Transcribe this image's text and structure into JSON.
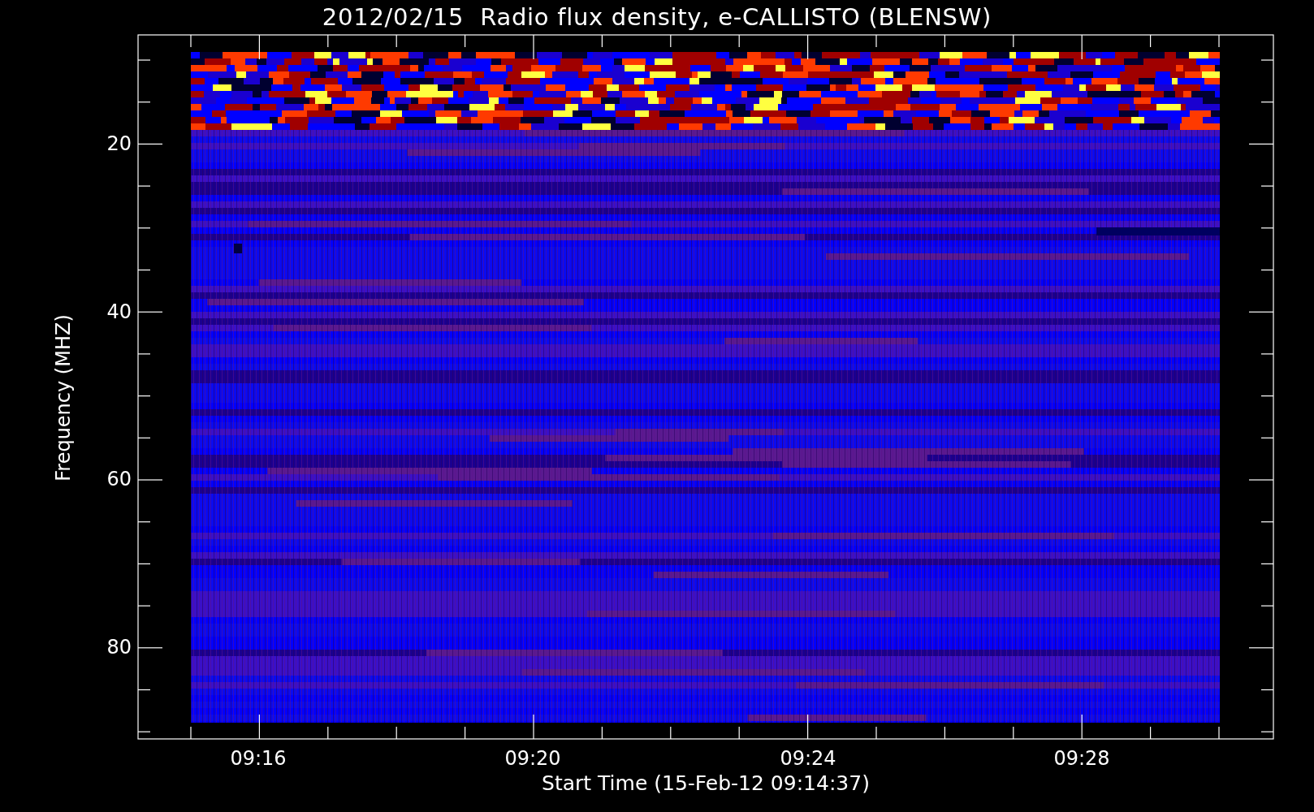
{
  "plot": {
    "title": "2012/02/15  Radio flux density, e-CALLISTO (BLENSW)",
    "ylabel": "Frequency (MHZ)",
    "xlabel": "Start Time (15-Feb-12 09:14:37)",
    "yticks": [
      "20",
      "40",
      "60",
      "80"
    ],
    "xticks": [
      "09:16",
      "09:20",
      "09:24",
      "09:28"
    ]
  }
}
